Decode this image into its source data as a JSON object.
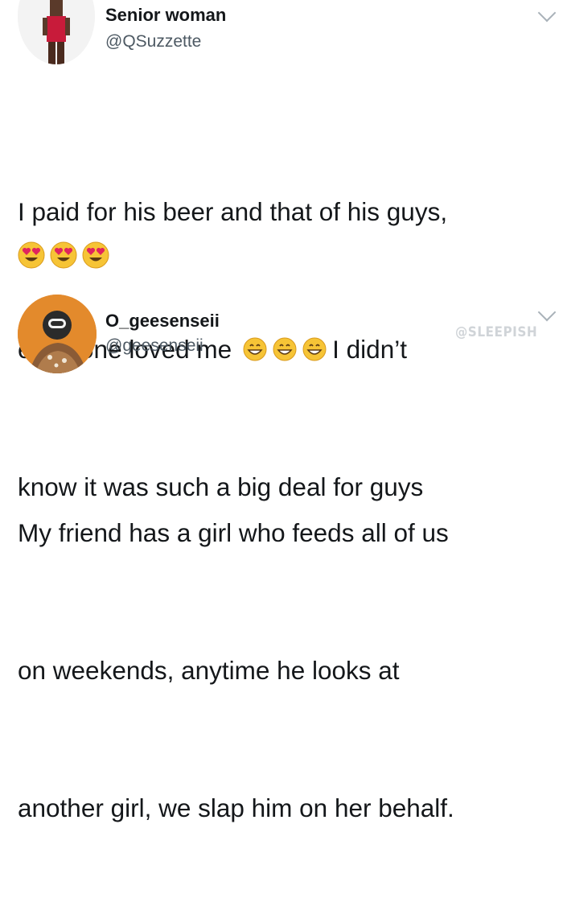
{
  "tweets": [
    {
      "display_name": "Senior woman",
      "handle": "@QSuzzette",
      "text_lines": [
        "I paid for his beer and that of his guys,",
        "everyone loved me",
        "I didn’t",
        "know it was such a big deal for guys"
      ],
      "inline_emojis": [
        "grinning-face-emoji",
        "grinning-face-emoji",
        "grinning-face-emoji"
      ],
      "trailing_emojis": [
        "heart-eyes-emoji",
        "heart-eyes-emoji",
        "heart-eyes-emoji"
      ],
      "menu_icon": "chevron-down-icon"
    },
    {
      "display_name": "O_geesenseii",
      "handle": "@geesenseii",
      "watermark": "@SLEEPISH",
      "text_lines": [
        "My friend has a girl who feeds all of us",
        "on weekends, anytime he looks at",
        "another girl, we slap him on her behalf."
      ],
      "menu_icon": "chevron-down-icon"
    }
  ],
  "colors": {
    "text": "#14171a",
    "handle": "#4d5963",
    "chevron": "#a9b2b9",
    "watermark": "#d0d4d8",
    "emoji_yellow": "#f6c436",
    "avatar2_bg": "#e38a2c"
  }
}
